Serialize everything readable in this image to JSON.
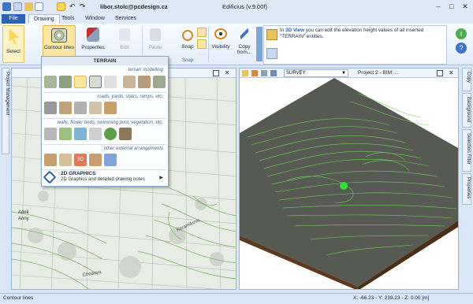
{
  "window": {
    "user": "libor.stolc@pcdesign.cz",
    "title": "Edificius (v.9.00f)"
  },
  "menu": {
    "file": "File",
    "tabs": [
      "Drawing",
      "Tools",
      "Window",
      "Services"
    ]
  },
  "ribbon": {
    "select": "Select",
    "contour": "Contour lines",
    "properties": "Properties",
    "edit": "Edit",
    "paste": "Paste",
    "snap": "Snap",
    "visibility": "Visibility",
    "copy_from": "Copy from...",
    "snap_group": "Snap",
    "info_prefix": "In ",
    "info_view": "3D View",
    "info_rest": " you can edit the elevation height values of all inserted \"TERRAIN\" entities."
  },
  "dropdown": {
    "header": "TERRAIN",
    "sections": [
      "terrain modelling",
      "roads, yards, stairs, ramps, etc.",
      "walls, flower beds, swimming pool, vegetation, etc.",
      "other external arrangements"
    ],
    "graphics_title": "2D GRAPHICS",
    "graphics_desc": "2D Graphics and detailed drawing notes"
  },
  "viewport_right": {
    "view_select": "SURVEY",
    "project": "Project 2 - BIM: ..."
  },
  "side_left": "Project Management",
  "side_right": [
    "Copy",
    "Background",
    "Selection Filter",
    "Properties"
  ],
  "map_labels": [
    "Adek",
    "Anny",
    "Chodova",
    "Keramikova"
  ],
  "status": {
    "left": "Contour lines",
    "coords": "X: -66.23 - Y: 239.23 - Z: 0.00 [m]"
  },
  "colors": {
    "contour": "#6fdc58",
    "terrain_side": "#5c3a1f",
    "ribbon_accent": "#2b63b8"
  }
}
